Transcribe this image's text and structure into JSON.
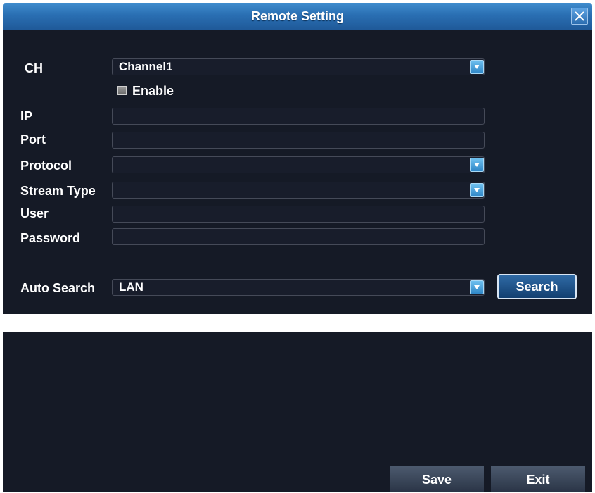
{
  "dialog": {
    "title": "Remote Setting",
    "close_icon": "close-icon"
  },
  "form": {
    "ch_label": "CH",
    "ch_value": "Channel1",
    "enable_label": "Enable",
    "enable_checked": false,
    "ip_label": "IP",
    "ip_value": "",
    "port_label": "Port",
    "port_value": "",
    "protocol_label": "Protocol",
    "protocol_value": "",
    "stream_type_label": "Stream Type",
    "stream_type_value": "",
    "user_label": "User",
    "user_value": "",
    "password_label": "Password",
    "password_value": "",
    "auto_search_label": "Auto Search",
    "auto_search_value": "LAN",
    "search_button": "Search"
  },
  "footer": {
    "save_button": "Save",
    "exit_button": "Exit"
  },
  "colors": {
    "title_bar": "#2a6fb3",
    "panel_bg": "#151a26",
    "accent": "#2f86c6"
  }
}
